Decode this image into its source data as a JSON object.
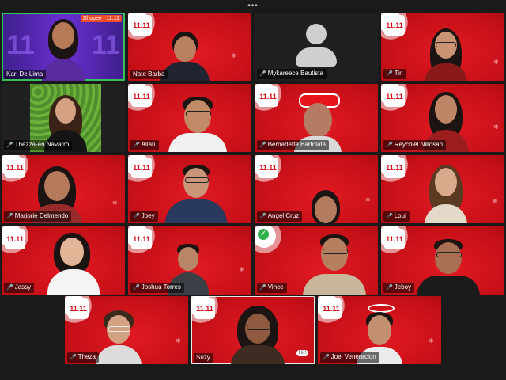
{
  "window": {
    "more_menu": "•••"
  },
  "colors": {
    "tile_red": "#c50f17",
    "active_border": "#36c35b",
    "mic_muted": "#ff4b4b"
  },
  "brand_badge": {
    "text": "Shopee | 11.11"
  },
  "logo_text": "11.11",
  "participants": [
    {
      "name": "Karl De Lima"
    },
    {
      "name": "Nate Barba"
    },
    {
      "name": "Mykareece Bautista"
    },
    {
      "name": "Tin"
    },
    {
      "name": "Thezza-en Navarro"
    },
    {
      "name": "Allan"
    },
    {
      "name": "Bernadette Bartolata"
    },
    {
      "name": "Reychiel Nillosan"
    },
    {
      "name": "Marjorie Delmendo"
    },
    {
      "name": "Joey"
    },
    {
      "name": "Angel Cruz"
    },
    {
      "name": "Loui"
    },
    {
      "name": "Jassy"
    },
    {
      "name": "Joshua Torres"
    },
    {
      "name": "Vince"
    },
    {
      "name": "Jeboy"
    },
    {
      "name": "Theza"
    },
    {
      "name": "Suzy"
    },
    {
      "name": "Joel Veneracion"
    }
  ],
  "big_text": "11",
  "speech_bubble": "Hi!!"
}
